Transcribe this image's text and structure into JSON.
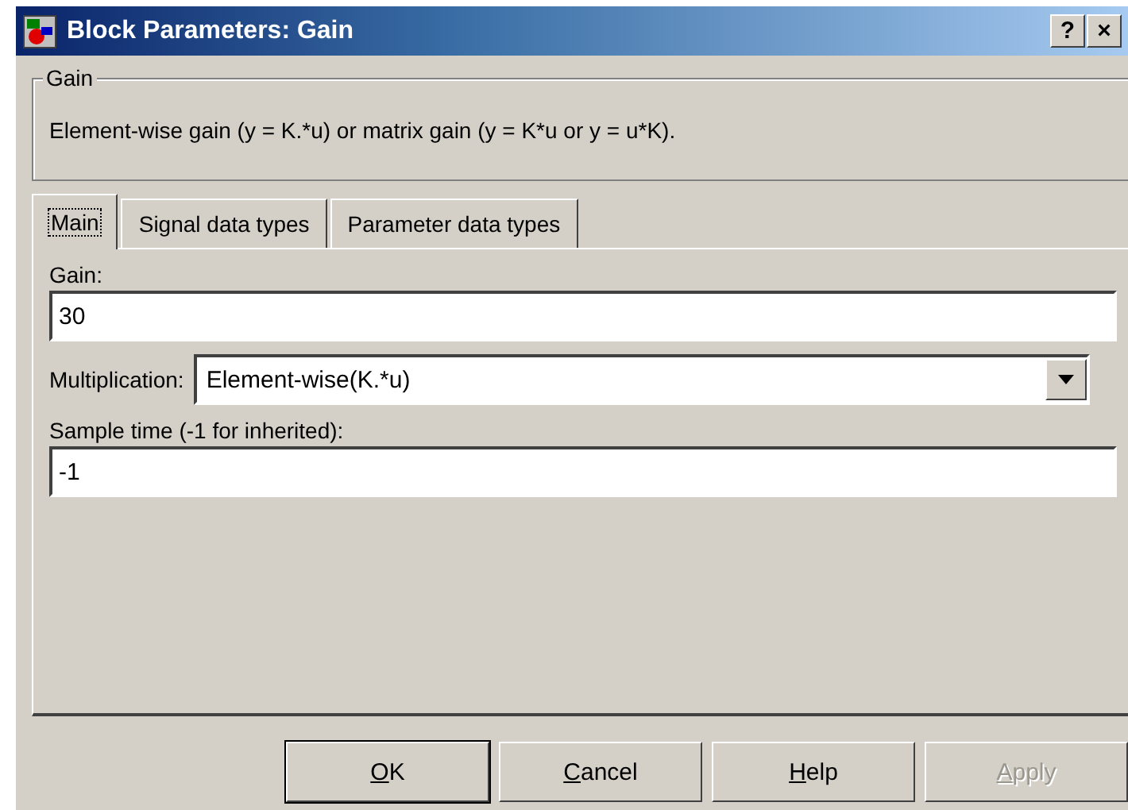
{
  "window": {
    "title": "Block Parameters: Gain",
    "title_buttons": [
      "?",
      "×"
    ]
  },
  "group": {
    "title": "Gain",
    "description": "Element-wise gain (y = K.*u) or matrix gain (y = K*u or y = u*K)."
  },
  "tabs": [
    {
      "label": "Main",
      "selected": true
    },
    {
      "label": "Signal data types",
      "selected": false
    },
    {
      "label": "Parameter data types",
      "selected": false
    }
  ],
  "fields": [
    {
      "kind": "text",
      "label": "Gain:",
      "value": "30"
    },
    {
      "kind": "dropdown",
      "label": "Multiplication:",
      "value": "Element-wise(K.*u)"
    },
    {
      "kind": "text",
      "label": "Sample time (-1 for inherited):",
      "value": "-1"
    }
  ],
  "buttons": [
    {
      "mnemonic": "O",
      "rest": "K",
      "disabled": false,
      "default": true
    },
    {
      "mnemonic": "C",
      "rest": "ancel",
      "disabled": false,
      "default": false
    },
    {
      "mnemonic": "H",
      "rest": "elp",
      "disabled": false,
      "default": false
    },
    {
      "mnemonic": "A",
      "rest": "pply",
      "disabled": true,
      "default": false
    }
  ]
}
